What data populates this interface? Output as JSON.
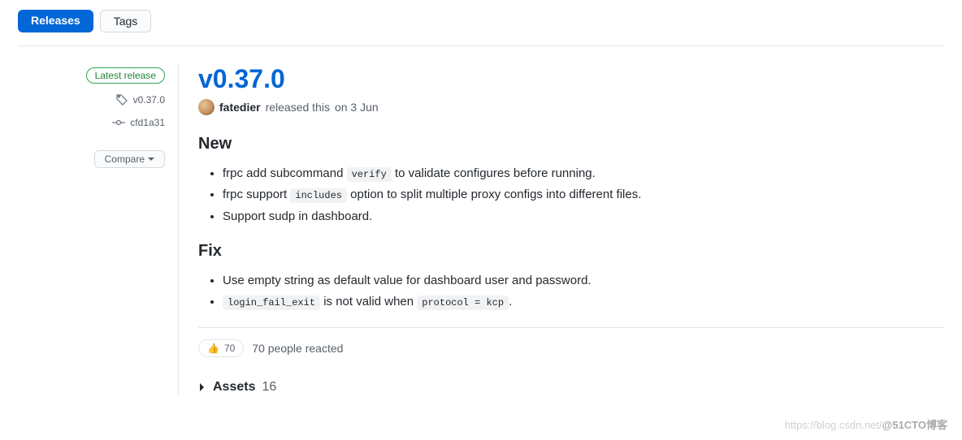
{
  "tabs": {
    "releases": "Releases",
    "tags": "Tags"
  },
  "sidebar": {
    "latest_badge": "Latest release",
    "tag": "v0.37.0",
    "commit": "cfd1a31",
    "compare": "Compare"
  },
  "release": {
    "title": "v0.37.0",
    "author": "fatedier",
    "released_text": "released this",
    "date": "on 3 Jun"
  },
  "sections": {
    "new_heading": "New",
    "fix_heading": "Fix",
    "new": [
      {
        "pre": "frpc add subcommand ",
        "code": "verify",
        "post": " to validate configures before running."
      },
      {
        "pre": "frpc support ",
        "code": "includes",
        "post": " option to split multiple proxy configs into different files."
      },
      {
        "pre": "Support sudp in dashboard."
      }
    ],
    "fix": [
      {
        "pre": "Use empty string as default value for dashboard user and password."
      },
      {
        "code": "login_fail_exit",
        "mid": " is not valid when ",
        "code2": "protocol = kcp",
        "post": "."
      }
    ]
  },
  "reactions": {
    "thumbs_emoji": "👍",
    "thumbs_count": "70",
    "summary": "70 people reacted"
  },
  "assets": {
    "label": "Assets",
    "count": "16"
  },
  "watermark": {
    "faint": "https://blog.csdn.net/",
    "bold": "@51CTO博客"
  }
}
